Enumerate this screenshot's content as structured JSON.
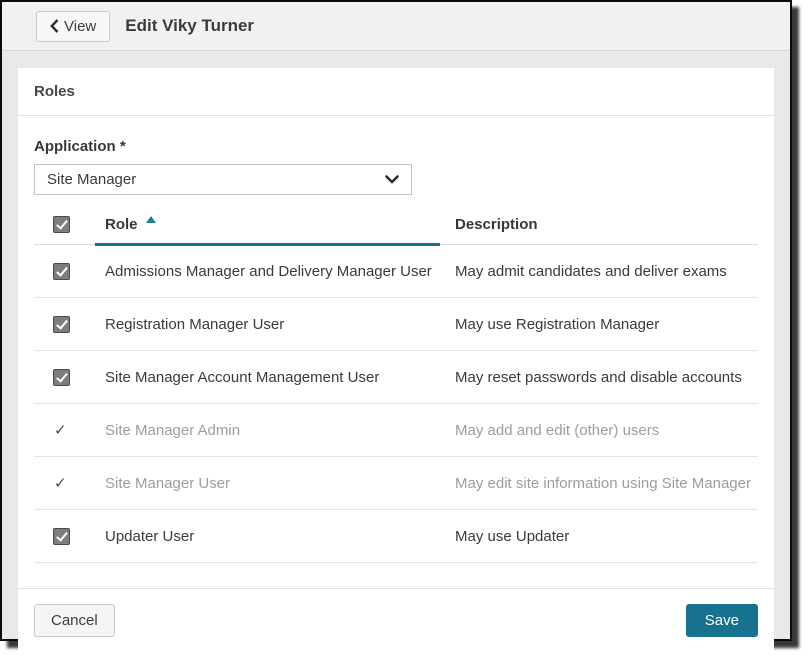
{
  "header": {
    "back_button_label": "View",
    "title": "Edit Viky Turner"
  },
  "roles_section": {
    "title": "Roles"
  },
  "application_field": {
    "label": "Application *",
    "selected_value": "Site Manager"
  },
  "roles_table": {
    "col_role": "Role",
    "col_description": "Description",
    "sort_column": "Role",
    "sort_direction": "ascending",
    "header_checkbox_state": "checked",
    "rows": [
      {
        "role": "Admissions Manager and Delivery Manager User",
        "description": "May admit candidates and deliver exams",
        "state": "checked"
      },
      {
        "role": "Registration Manager User",
        "description": "May use Registration Manager",
        "state": "checked"
      },
      {
        "role": "Site Manager Account Management User",
        "description": "May reset passwords and disable accounts",
        "state": "checked"
      },
      {
        "role": "Site Manager Admin",
        "description": "May add and edit (other) users",
        "state": "locked"
      },
      {
        "role": "Site Manager User",
        "description": "May edit site information using Site Manager",
        "state": "locked"
      },
      {
        "role": "Updater User",
        "description": "May use Updater",
        "state": "checked"
      }
    ]
  },
  "actions": {
    "cancel_label": "Cancel",
    "save_label": "Save"
  },
  "colors": {
    "accent": "#17728f",
    "checkbox_fill": "#7d7d7d",
    "disabled_text": "#9d9d9d",
    "window_border": "#0b0b0b"
  }
}
